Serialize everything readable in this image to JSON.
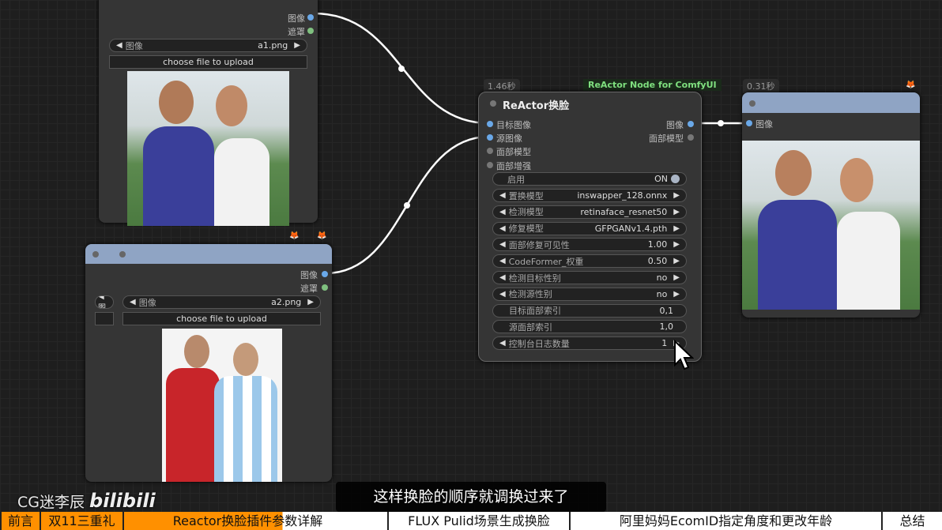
{
  "load_node_1": {
    "outputs": [
      "图像",
      "遮罩"
    ],
    "image_label": "图像",
    "image_value": "a1.png",
    "upload_label": "choose file to upload"
  },
  "load_node_2": {
    "outputs": [
      "图像",
      "遮罩"
    ],
    "image_label": "图像",
    "image_value": "a2.png",
    "upload_label": "choose file to upload",
    "left_combo": "◀ 图"
  },
  "reactor": {
    "time": "1.46秒",
    "badge": "ReActor Node for ComfyUI",
    "title": "ReActor换脸",
    "inputs": [
      "目标图像",
      "源图像",
      "面部模型",
      "面部增强"
    ],
    "outputs": [
      "图像",
      "面部模型"
    ],
    "toggle": {
      "name": "启用",
      "value": "ON"
    },
    "widgets": [
      {
        "name": "置换模型",
        "value": "inswapper_128.onnx",
        "arrows": true
      },
      {
        "name": "检测模型",
        "value": "retinaface_resnet50",
        "arrows": true
      },
      {
        "name": "修复模型",
        "value": "GFPGANv1.4.pth",
        "arrows": true
      },
      {
        "name": "面部修复可见性",
        "value": "1.00",
        "arrows": true
      },
      {
        "name": "CodeFormer_权重",
        "value": "0.50",
        "arrows": true
      },
      {
        "name": "检测目标性别",
        "value": "no",
        "arrows": true
      },
      {
        "name": "检测源性别",
        "value": "no",
        "arrows": true
      },
      {
        "name": "目标面部索引",
        "value": "0,1",
        "arrows": false
      },
      {
        "name": "源面部索引",
        "value": "1,0",
        "arrows": false
      },
      {
        "name": "控制台日志数量",
        "value": "1",
        "arrows": true
      }
    ]
  },
  "preview": {
    "time": "0.31秒",
    "input": "图像"
  },
  "overlay": {
    "watermark": "CG迷李辰",
    "logo": "bilibili",
    "subtitle": "这样换脸的顺序就调换过来了"
  },
  "chapters": [
    "前言",
    "双11三重礼",
    "Reactor换脸插件参数详解",
    "FLUX Pulid场景生成换脸",
    "阿里妈妈EcomID指定角度和更改年龄",
    "总结"
  ],
  "colors": {
    "accent": "#ff9000",
    "node_header": "#8fa4c4",
    "link": "#ffffff",
    "badge_green": "#6fd06f"
  }
}
